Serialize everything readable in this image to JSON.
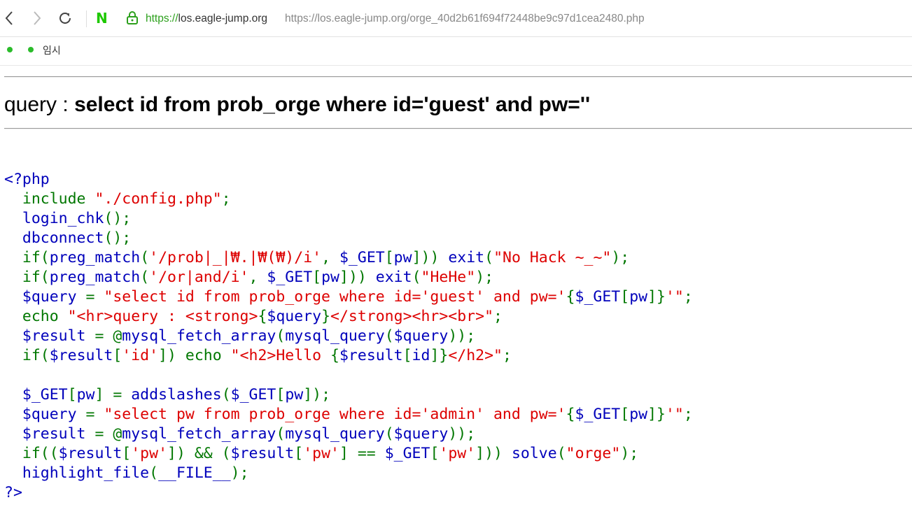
{
  "browser": {
    "url_scheme": "https://",
    "url_host": "los.eagle-jump.org",
    "url_full": "https://los.eagle-jump.org/orge_40d2b61f694f72448be9c97d1cea2480.php",
    "back_icon": "chevron-left-icon",
    "forward_icon": "chevron-right-icon",
    "reload_icon": "reload-icon",
    "logo_icon": "naver-n-icon",
    "lock_icon": "lock-icon"
  },
  "bookmarks": {
    "label": "임시"
  },
  "page": {
    "query_label": "query : ",
    "query_text": "select id from prob_orge where id='guest' and pw=''"
  },
  "code_lines": [
    [
      {
        "c": "df",
        "t": "<?php"
      }
    ],
    [
      {
        "c": "kw",
        "t": "  include "
      },
      {
        "c": "st",
        "t": "\"./config.php\""
      },
      {
        "c": "kw",
        "t": ";"
      }
    ],
    [
      {
        "c": "df",
        "t": "  login_chk"
      },
      {
        "c": "kw",
        "t": "();"
      }
    ],
    [
      {
        "c": "df",
        "t": "  dbconnect"
      },
      {
        "c": "kw",
        "t": "();"
      }
    ],
    [
      {
        "c": "kw",
        "t": "  if("
      },
      {
        "c": "df",
        "t": "preg_match"
      },
      {
        "c": "kw",
        "t": "("
      },
      {
        "c": "st",
        "t": "'/prob|_|₩.|₩(₩)/i'"
      },
      {
        "c": "kw",
        "t": ", "
      },
      {
        "c": "df",
        "t": "$_GET"
      },
      {
        "c": "kw",
        "t": "["
      },
      {
        "c": "df",
        "t": "pw"
      },
      {
        "c": "kw",
        "t": "])) "
      },
      {
        "c": "df",
        "t": "exit"
      },
      {
        "c": "kw",
        "t": "("
      },
      {
        "c": "st",
        "t": "\"No Hack ~_~\""
      },
      {
        "c": "kw",
        "t": ");"
      }
    ],
    [
      {
        "c": "kw",
        "t": "  if("
      },
      {
        "c": "df",
        "t": "preg_match"
      },
      {
        "c": "kw",
        "t": "("
      },
      {
        "c": "st",
        "t": "'/or|and/i'"
      },
      {
        "c": "kw",
        "t": ", "
      },
      {
        "c": "df",
        "t": "$_GET"
      },
      {
        "c": "kw",
        "t": "["
      },
      {
        "c": "df",
        "t": "pw"
      },
      {
        "c": "kw",
        "t": "])) "
      },
      {
        "c": "df",
        "t": "exit"
      },
      {
        "c": "kw",
        "t": "("
      },
      {
        "c": "st",
        "t": "\"HeHe\""
      },
      {
        "c": "kw",
        "t": ");"
      }
    ],
    [
      {
        "c": "df",
        "t": "  $query "
      },
      {
        "c": "kw",
        "t": "= "
      },
      {
        "c": "st",
        "t": "\"select id from prob_orge where id='guest' and pw='"
      },
      {
        "c": "kw",
        "t": "{"
      },
      {
        "c": "df",
        "t": "$_GET"
      },
      {
        "c": "kw",
        "t": "["
      },
      {
        "c": "df",
        "t": "pw"
      },
      {
        "c": "kw",
        "t": "]}"
      },
      {
        "c": "st",
        "t": "'\""
      },
      {
        "c": "kw",
        "t": ";"
      }
    ],
    [
      {
        "c": "kw",
        "t": "  echo "
      },
      {
        "c": "st",
        "t": "\"<hr>query : <strong>"
      },
      {
        "c": "kw",
        "t": "{"
      },
      {
        "c": "df",
        "t": "$query"
      },
      {
        "c": "kw",
        "t": "}"
      },
      {
        "c": "st",
        "t": "</strong><hr><br>\""
      },
      {
        "c": "kw",
        "t": ";"
      }
    ],
    [
      {
        "c": "df",
        "t": "  $result "
      },
      {
        "c": "kw",
        "t": "= @"
      },
      {
        "c": "df",
        "t": "mysql_fetch_array"
      },
      {
        "c": "kw",
        "t": "("
      },
      {
        "c": "df",
        "t": "mysql_query"
      },
      {
        "c": "kw",
        "t": "("
      },
      {
        "c": "df",
        "t": "$query"
      },
      {
        "c": "kw",
        "t": "));"
      }
    ],
    [
      {
        "c": "kw",
        "t": "  if("
      },
      {
        "c": "df",
        "t": "$result"
      },
      {
        "c": "kw",
        "t": "["
      },
      {
        "c": "st",
        "t": "'id'"
      },
      {
        "c": "kw",
        "t": "]) echo "
      },
      {
        "c": "st",
        "t": "\"<h2>Hello "
      },
      {
        "c": "kw",
        "t": "{"
      },
      {
        "c": "df",
        "t": "$result"
      },
      {
        "c": "kw",
        "t": "["
      },
      {
        "c": "df",
        "t": "id"
      },
      {
        "c": "kw",
        "t": "]}"
      },
      {
        "c": "st",
        "t": "</h2>\""
      },
      {
        "c": "kw",
        "t": ";"
      }
    ],
    [
      {
        "c": "kw",
        "t": " "
      }
    ],
    [
      {
        "c": "df",
        "t": "  $_GET"
      },
      {
        "c": "kw",
        "t": "["
      },
      {
        "c": "df",
        "t": "pw"
      },
      {
        "c": "kw",
        "t": "] = "
      },
      {
        "c": "df",
        "t": "addslashes"
      },
      {
        "c": "kw",
        "t": "("
      },
      {
        "c": "df",
        "t": "$_GET"
      },
      {
        "c": "kw",
        "t": "["
      },
      {
        "c": "df",
        "t": "pw"
      },
      {
        "c": "kw",
        "t": "]);"
      }
    ],
    [
      {
        "c": "df",
        "t": "  $query "
      },
      {
        "c": "kw",
        "t": "= "
      },
      {
        "c": "st",
        "t": "\"select pw from prob_orge where id='admin' and pw='"
      },
      {
        "c": "kw",
        "t": "{"
      },
      {
        "c": "df",
        "t": "$_GET"
      },
      {
        "c": "kw",
        "t": "["
      },
      {
        "c": "df",
        "t": "pw"
      },
      {
        "c": "kw",
        "t": "]}"
      },
      {
        "c": "st",
        "t": "'\""
      },
      {
        "c": "kw",
        "t": ";"
      }
    ],
    [
      {
        "c": "df",
        "t": "  $result "
      },
      {
        "c": "kw",
        "t": "= @"
      },
      {
        "c": "df",
        "t": "mysql_fetch_array"
      },
      {
        "c": "kw",
        "t": "("
      },
      {
        "c": "df",
        "t": "mysql_query"
      },
      {
        "c": "kw",
        "t": "("
      },
      {
        "c": "df",
        "t": "$query"
      },
      {
        "c": "kw",
        "t": "));"
      }
    ],
    [
      {
        "c": "kw",
        "t": "  if(("
      },
      {
        "c": "df",
        "t": "$result"
      },
      {
        "c": "kw",
        "t": "["
      },
      {
        "c": "st",
        "t": "'pw'"
      },
      {
        "c": "kw",
        "t": "]) && ("
      },
      {
        "c": "df",
        "t": "$result"
      },
      {
        "c": "kw",
        "t": "["
      },
      {
        "c": "st",
        "t": "'pw'"
      },
      {
        "c": "kw",
        "t": "] == "
      },
      {
        "c": "df",
        "t": "$_GET"
      },
      {
        "c": "kw",
        "t": "["
      },
      {
        "c": "st",
        "t": "'pw'"
      },
      {
        "c": "kw",
        "t": "])) "
      },
      {
        "c": "df",
        "t": "solve"
      },
      {
        "c": "kw",
        "t": "("
      },
      {
        "c": "st",
        "t": "\"orge\""
      },
      {
        "c": "kw",
        "t": ");"
      }
    ],
    [
      {
        "c": "df",
        "t": "  highlight_file"
      },
      {
        "c": "kw",
        "t": "("
      },
      {
        "c": "df",
        "t": "__FILE__"
      },
      {
        "c": "kw",
        "t": ");"
      }
    ],
    [
      {
        "c": "df",
        "t": "?>"
      }
    ]
  ]
}
